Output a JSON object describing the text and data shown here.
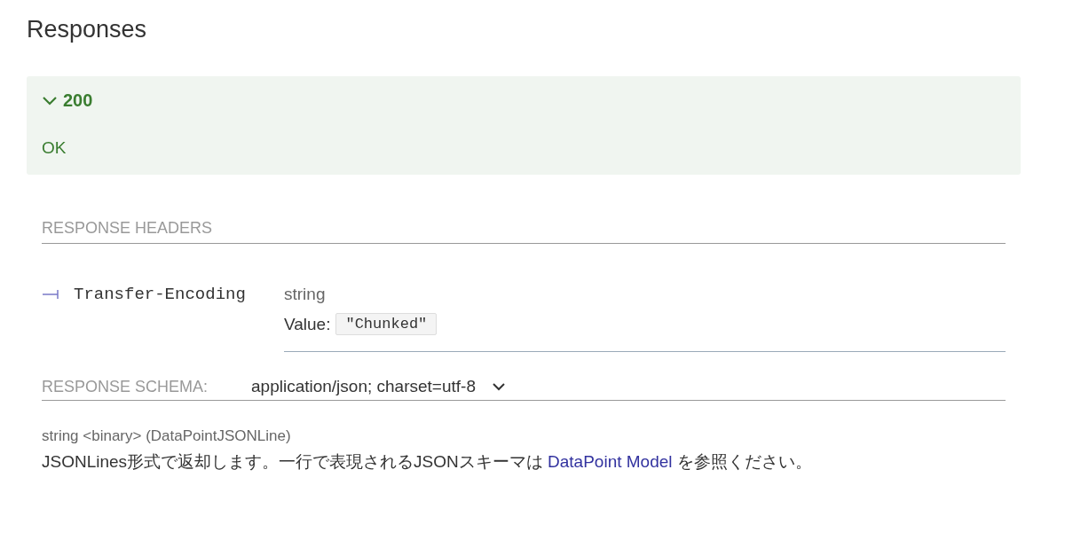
{
  "title": "Responses",
  "response": {
    "code": "200",
    "expanded": true,
    "description": "OK"
  },
  "headers_label": "RESPONSE HEADERS",
  "headers": [
    {
      "name": "Transfer-Encoding",
      "type": "string",
      "value_label": "Value:",
      "value": "\"Chunked\""
    }
  ],
  "schema": {
    "label": "RESPONSE SCHEMA:",
    "content_type": "application/json; charset=utf-8",
    "type_line": "string <binary> (DataPointJSONLine)",
    "description": {
      "text_before": "JSONLines形式で返却します。一行で表現されるJSONスキーマは ",
      "link": "DataPoint Model",
      "text_after": " を参照ください。"
    }
  }
}
